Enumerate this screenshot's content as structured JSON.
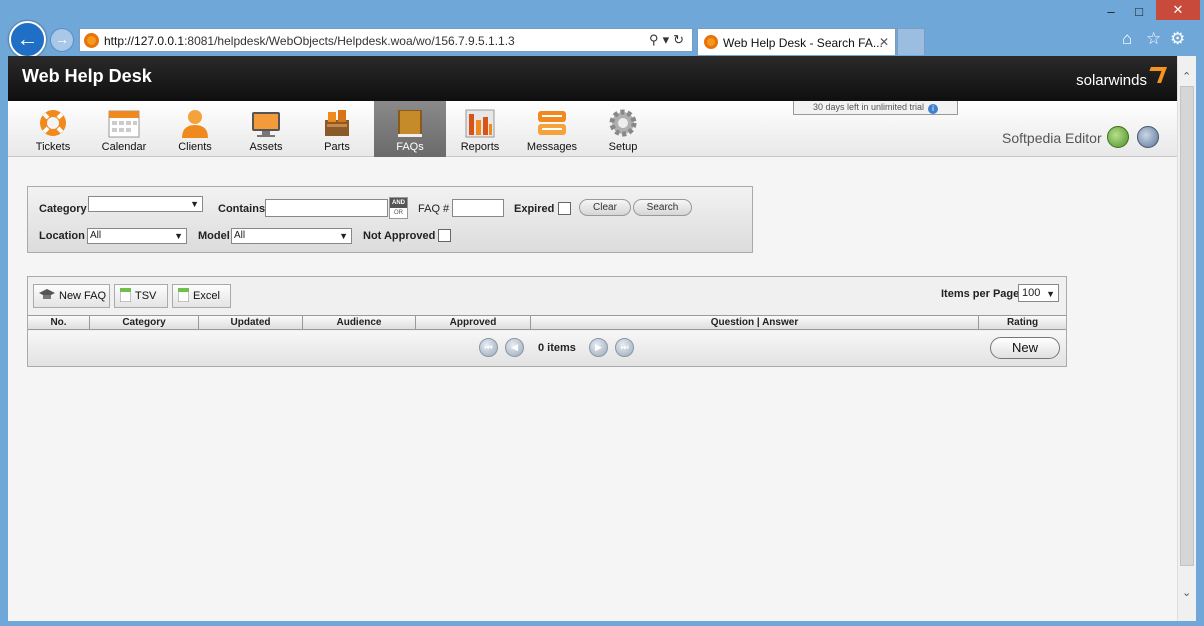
{
  "browser": {
    "url_host": "http://127.0.0.1",
    "url_rest": ":8081/helpdesk/WebObjects/Helpdesk.woa/wo/156.7.9.5.1.1.3",
    "tab_title": "Web Help Desk - Search FA...",
    "icons": [
      "back-icon",
      "forward-icon",
      "search-icon",
      "refresh-icon",
      "home-icon",
      "favorites-icon",
      "gear-icon"
    ]
  },
  "app": {
    "title": "Web Help Desk",
    "brand": "solarwinds",
    "trial_text": "30 days left in unlimited trial",
    "user": "Softpedia Editor"
  },
  "toolbar": {
    "items": [
      {
        "label": "Tickets"
      },
      {
        "label": "Calendar"
      },
      {
        "label": "Clients"
      },
      {
        "label": "Assets"
      },
      {
        "label": "Parts"
      },
      {
        "label": "FAQs",
        "active": true
      },
      {
        "label": "Reports"
      },
      {
        "label": "Messages"
      },
      {
        "label": "Setup"
      }
    ]
  },
  "search": {
    "category_label": "Category",
    "category_value": "",
    "contains_label": "Contains",
    "contains_value": "",
    "and_label": "AND",
    "or_label": "OR",
    "faq_label": "FAQ #",
    "faq_value": "",
    "expired_label": "Expired",
    "clear_label": "Clear",
    "search_label": "Search",
    "location_label": "Location",
    "location_value": "All",
    "model_label": "Model",
    "model_value": "All",
    "not_approved_label": "Not Approved"
  },
  "results": {
    "new_faq_label": "New FAQ",
    "tsv_label": "TSV",
    "excel_label": "Excel",
    "items_per_page_label": "Items per Page",
    "items_per_page_value": "100",
    "columns": [
      "No.",
      "Category",
      "Updated",
      "Audience",
      "Approved",
      "Question | Answer",
      "Rating"
    ],
    "count_text": "0 items",
    "new_label": "New"
  },
  "colors": {
    "accent_orange": "#f7941d",
    "header_black": "#141414",
    "browser_frame": "#6fa7d8"
  }
}
